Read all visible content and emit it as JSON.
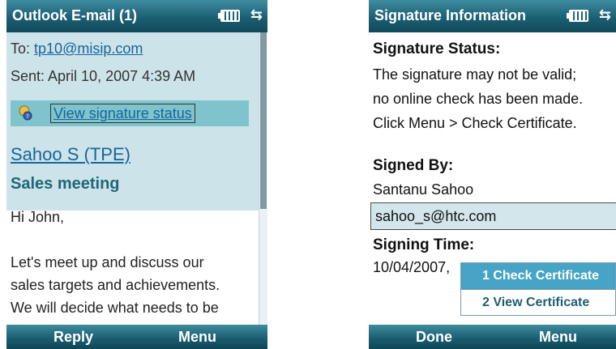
{
  "left_screen": {
    "title": "Outlook E-mail (1)",
    "to_label": "To:",
    "to_address": "tp10@misip.com",
    "sent": "Sent: April 10, 2007 4:39 AM",
    "signature_link": "View signature status",
    "sender": "Sahoo S (TPE)",
    "subject": "Sales meeting",
    "body_lines": [
      "Hi John,",
      "",
      "Let's meet up and discuss our",
      "sales targets and achievements.",
      "We will decide what needs to be"
    ],
    "softkeys": {
      "left": "Reply",
      "right": "Menu"
    }
  },
  "right_screen": {
    "title": "Signature Information",
    "status_label": "Signature Status:",
    "status_lines": [
      "The signature may not be valid;",
      "no online check has been made.",
      "Click Menu > Check Certificate."
    ],
    "signed_by_label": "Signed By:",
    "signed_by_name": "Santanu Sahoo",
    "signed_by_email": "sahoo_s@htc.com",
    "signing_time_label": "Signing Time:",
    "signing_time": "10/04/2007,",
    "menu": [
      "1 Check Certificate",
      "2 View Certificate"
    ],
    "softkeys": {
      "left": "Done",
      "right": "Menu"
    }
  },
  "colors": {
    "title_bar": "#1c5f72",
    "header_bg": "#cde3ea",
    "highlight": "#7fc3cd",
    "selected_menu": "#46a4c6",
    "link": "#17659a"
  },
  "icons": [
    "battery-icon",
    "connectivity-icon",
    "certificate-icon"
  ]
}
